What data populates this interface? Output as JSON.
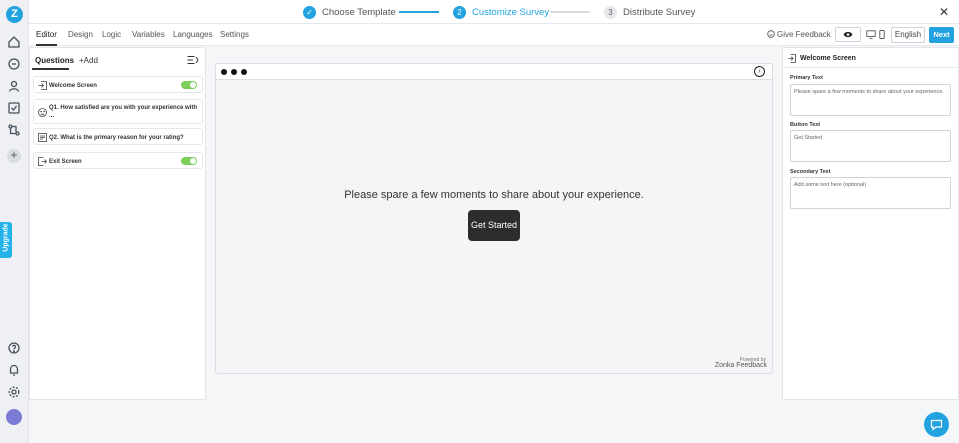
{
  "rail": {
    "logo": "Z",
    "upgrade_label": "Upgrade"
  },
  "steps": [
    {
      "num": "✓",
      "label": "Choose Template",
      "state": "done"
    },
    {
      "num": "2",
      "label": "Customize Survey",
      "state": "active"
    },
    {
      "num": "3",
      "label": "Distribute Survey",
      "state": "todo"
    }
  ],
  "close_label": "✕",
  "tabs": [
    "Editor",
    "Design",
    "Logic",
    "Variables",
    "Languages",
    "Settings"
  ],
  "toolbar": {
    "feedback_label": "Give Feedback",
    "language": "English",
    "next_label": "Next"
  },
  "questions_panel": {
    "heading": "Questions",
    "add_label": "+Add",
    "items": [
      {
        "label": "Welcome Screen",
        "toggle": true
      },
      {
        "label": "Q1. How satisfied are you with your experience with ...",
        "toggle": false
      },
      {
        "label": "Q2. What is the primary reason for your rating?",
        "toggle": false
      },
      {
        "label": "Exit Screen",
        "toggle": true
      }
    ]
  },
  "preview": {
    "primary_text": "Please spare a few moments to share about your experience.",
    "button_text": "Get Started",
    "next_arrow": "›",
    "powered_by": "Powered by",
    "brand": "Zonka Feedback"
  },
  "settings_panel": {
    "title": "Welcome Screen",
    "fields": [
      {
        "label": "Primary Text",
        "value": "Please spare a few moments to share about your experience."
      },
      {
        "label": "Button Text",
        "value": "Get Started"
      },
      {
        "label": "Secondary Text",
        "value": "Add some text here (optional)"
      }
    ]
  },
  "colors": {
    "accent": "#22a3e0",
    "toggle_on": "#7ccd5a",
    "preview_button": "#2d2d2d"
  }
}
